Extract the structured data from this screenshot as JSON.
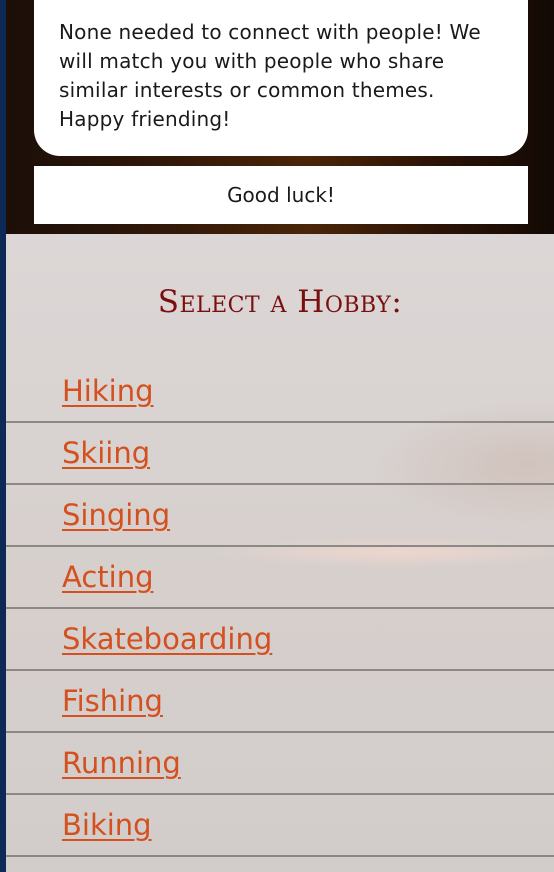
{
  "intro": {
    "text": "None needed to connect with people! We will match you with people who share similar interests or common themes. Happy friending!",
    "good_luck": "Good luck!"
  },
  "hobbies": {
    "title": "Select a Hobby:",
    "items": [
      {
        "label": "Hiking"
      },
      {
        "label": "Skiing"
      },
      {
        "label": "Singing"
      },
      {
        "label": "Acting"
      },
      {
        "label": "Skateboarding"
      },
      {
        "label": "Fishing"
      },
      {
        "label": "Running"
      },
      {
        "label": "Biking"
      }
    ]
  },
  "colors": {
    "title": "#7a0f10",
    "link": "#d4501f",
    "divider": "#8b8886"
  }
}
